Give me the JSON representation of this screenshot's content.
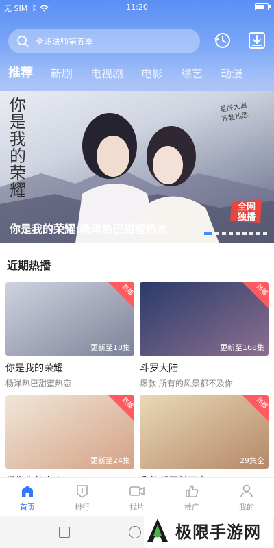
{
  "status_bar": {
    "carrier": "无 SIM 卡",
    "time": "11:20",
    "battery_level": 0.8
  },
  "search": {
    "placeholder": "全职法师第五季"
  },
  "tabs": [
    {
      "label": "推荐",
      "active": true
    },
    {
      "label": "新剧",
      "active": false
    },
    {
      "label": "电视剧",
      "active": false
    },
    {
      "label": "电影",
      "active": false
    },
    {
      "label": "综艺",
      "active": false
    },
    {
      "label": "动漫",
      "active": false
    }
  ],
  "banner": {
    "caption": "你是我的荣耀:杨洋热巴甜蜜热恋",
    "calligraphy": "你是我的荣耀",
    "slogan_1": "星辰大海",
    "slogan_2": "齐赴热恋",
    "badge_1": "全网",
    "badge_2": "独播",
    "dot_count": 9,
    "active_dot": 0
  },
  "section": {
    "title": "近期热播"
  },
  "hot_label": "热播",
  "cards": [
    {
      "title": "你是我的荣耀",
      "desc": "杨洋热巴甜蜜热恋",
      "update": "更新至18集",
      "colors": [
        "#cfd3df",
        "#7d8299"
      ]
    },
    {
      "title": "斗罗大陆",
      "desc": "爆款 所有的风景都不及你",
      "update": "更新至168集",
      "colors": [
        "#2a3b6a",
        "#8c6f8f"
      ]
    },
    {
      "title": "都失失的亲亲王子",
      "desc": "",
      "update": "更新至24集",
      "colors": [
        "#f1e6d8",
        "#d3a286"
      ]
    },
    {
      "title": "我的邻居长不大",
      "desc": "",
      "update": "29集全",
      "colors": [
        "#e9d9b6",
        "#b48868"
      ]
    }
  ],
  "bottom_nav": [
    {
      "label": "首页",
      "icon": "home-icon",
      "active": true
    },
    {
      "label": "排行",
      "icon": "ranking-icon",
      "active": false
    },
    {
      "label": "找片",
      "icon": "video-camera-icon",
      "active": false
    },
    {
      "label": "推广",
      "icon": "thumbs-up-icon",
      "active": false
    },
    {
      "label": "我的",
      "icon": "user-icon",
      "active": false
    }
  ],
  "watermark": {
    "text": "极限手游网"
  },
  "colors": {
    "accent": "#2f7cf6",
    "hot_badge": "#ff5a5f",
    "banner_badge": "#e8453c"
  }
}
